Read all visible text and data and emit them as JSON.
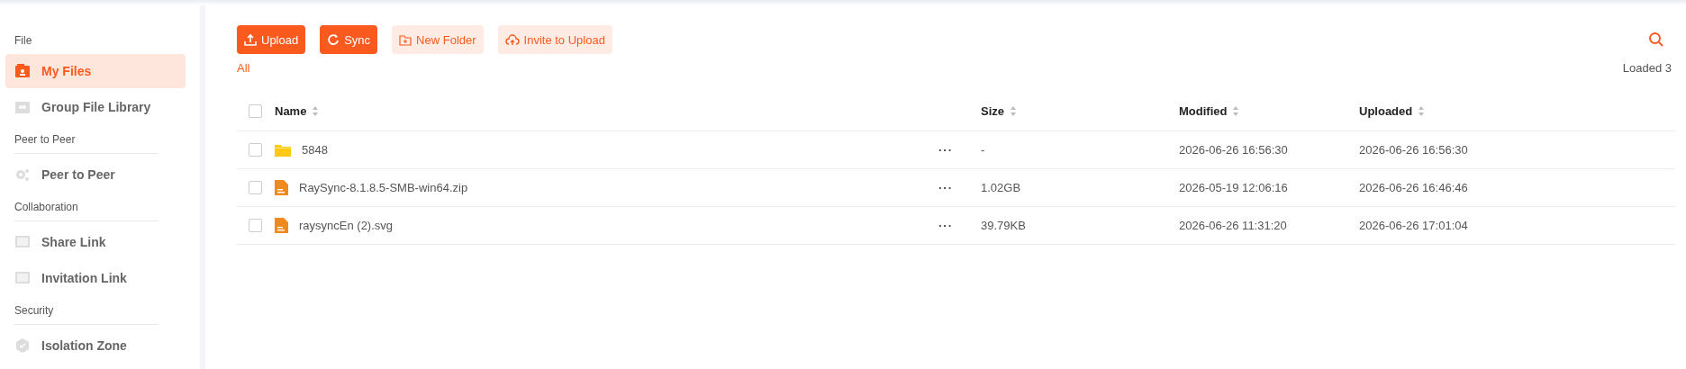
{
  "sidebar": {
    "sections": [
      {
        "title": "File",
        "items": [
          {
            "label": "My Files",
            "selected": true
          },
          {
            "label": "Group File Library",
            "selected": false
          }
        ]
      },
      {
        "title": "Peer to Peer",
        "items": [
          {
            "label": "Peer to Peer",
            "selected": false
          }
        ]
      },
      {
        "title": "Collaboration",
        "items": [
          {
            "label": "Share Link",
            "selected": false
          },
          {
            "label": "Invitation Link",
            "selected": false
          }
        ]
      },
      {
        "title": "Security",
        "items": [
          {
            "label": "Isolation Zone",
            "selected": false
          }
        ]
      }
    ]
  },
  "toolbar": {
    "buttons": [
      {
        "label": "Upload",
        "kind": "primary"
      },
      {
        "label": "Sync",
        "kind": "primary"
      },
      {
        "label": "New Folder",
        "kind": "light"
      },
      {
        "label": "Invite to Upload",
        "kind": "light"
      }
    ]
  },
  "breadcrumb": "All",
  "loaded": "Loaded 3",
  "table": {
    "select_all": {
      "checked": false
    },
    "columns": [
      "Name",
      "Size",
      "Modified",
      "Uploaded"
    ],
    "rows": [
      {
        "kind": "folder",
        "checked": false,
        "name": "5848",
        "more": "···",
        "size": "-",
        "modified": "2026-06-26 16:56:30",
        "uploaded": "2026-06-26 16:56:30"
      },
      {
        "kind": "file",
        "checked": false,
        "name": "RaySync-8.1.8.5-SMB-win64.zip",
        "more": "···",
        "size": "1.02GB",
        "modified": "2026-05-19 12:06:16",
        "uploaded": "2026-06-26 16:46:46"
      },
      {
        "kind": "file",
        "checked": false,
        "name": "raysyncEn (2).svg",
        "more": "···",
        "size": "39.79KB",
        "modified": "2026-06-26 11:31:20",
        "uploaded": "2026-06-26 17:01:04"
      }
    ]
  }
}
